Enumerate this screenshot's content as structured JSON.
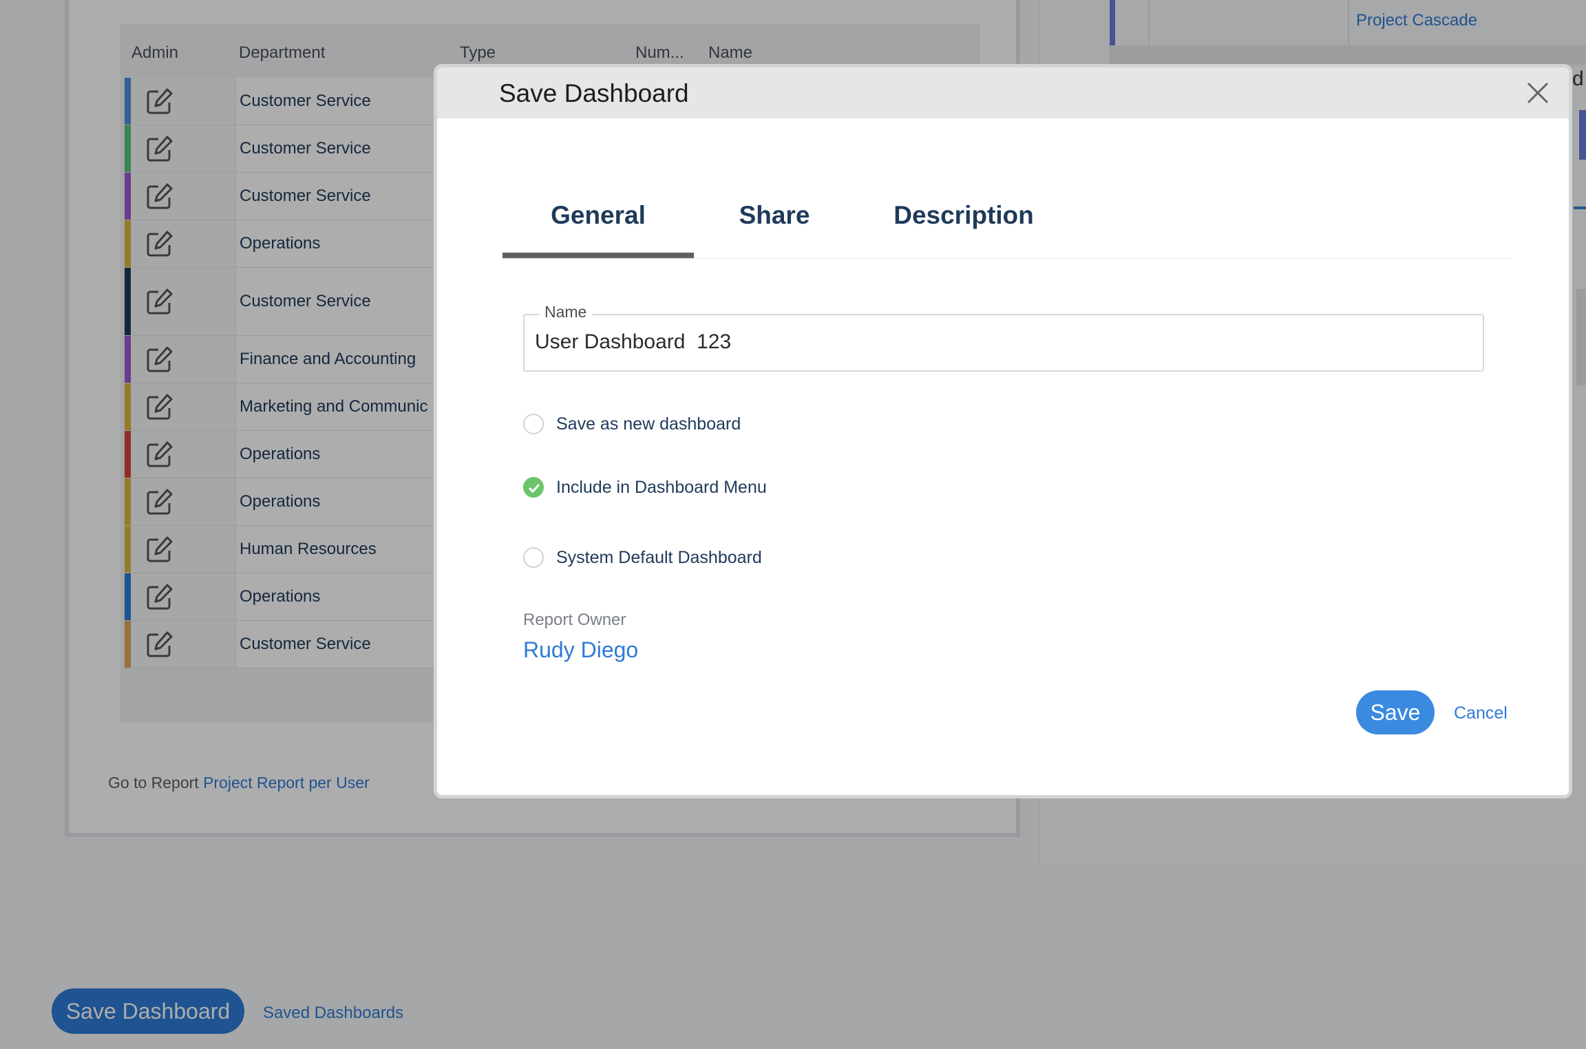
{
  "background": {
    "grid": {
      "columns": [
        "Admin",
        "Department",
        "Type",
        "Num...",
        "Name"
      ],
      "rows": [
        {
          "department": "Customer Service",
          "color": "#4a90d9"
        },
        {
          "department": "Customer Service",
          "color": "#5cc27a"
        },
        {
          "department": "Customer Service",
          "color": "#9b59d0"
        },
        {
          "department": "Operations",
          "color": "#e0b53a"
        },
        {
          "department": "Customer Service",
          "color": "#1f3a5a"
        },
        {
          "department": "Finance and Accounting",
          "color": "#9b59d0"
        },
        {
          "department": "Marketing and Communic",
          "color": "#e0b53a"
        },
        {
          "department": "Operations",
          "color": "#d9433b"
        },
        {
          "department": "Operations",
          "color": "#e0b53a"
        },
        {
          "department": "Human Resources",
          "color": "#d6b84a"
        },
        {
          "department": "Operations",
          "color": "#2f7bd6"
        },
        {
          "department": "Customer Service",
          "color": "#e2a55a"
        }
      ]
    },
    "go_to_report_prefix": "Go to Report",
    "go_to_report_link": "Project Report per User",
    "right_panel_link": "Project Cascade",
    "right_panel_letter": "d",
    "save_dashboard_button": "Save Dashboard",
    "saved_dashboards_link": "Saved Dashboards"
  },
  "modal": {
    "title": "Save Dashboard",
    "tabs": [
      {
        "label": "General",
        "active": true
      },
      {
        "label": "Share",
        "active": false
      },
      {
        "label": "Description",
        "active": false
      }
    ],
    "name_field": {
      "label": "Name",
      "value": "User Dashboard  123"
    },
    "options": [
      {
        "label": "Save as new dashboard",
        "checked": false
      },
      {
        "label": "Include in Dashboard Menu",
        "checked": true
      },
      {
        "label": "System Default Dashboard",
        "checked": false
      }
    ],
    "report_owner_label": "Report Owner",
    "report_owner_value": "Rudy Diego",
    "save_label": "Save",
    "cancel_label": "Cancel"
  },
  "colors": {
    "accent": "#2f7bd6",
    "check": "#6cc46c"
  }
}
